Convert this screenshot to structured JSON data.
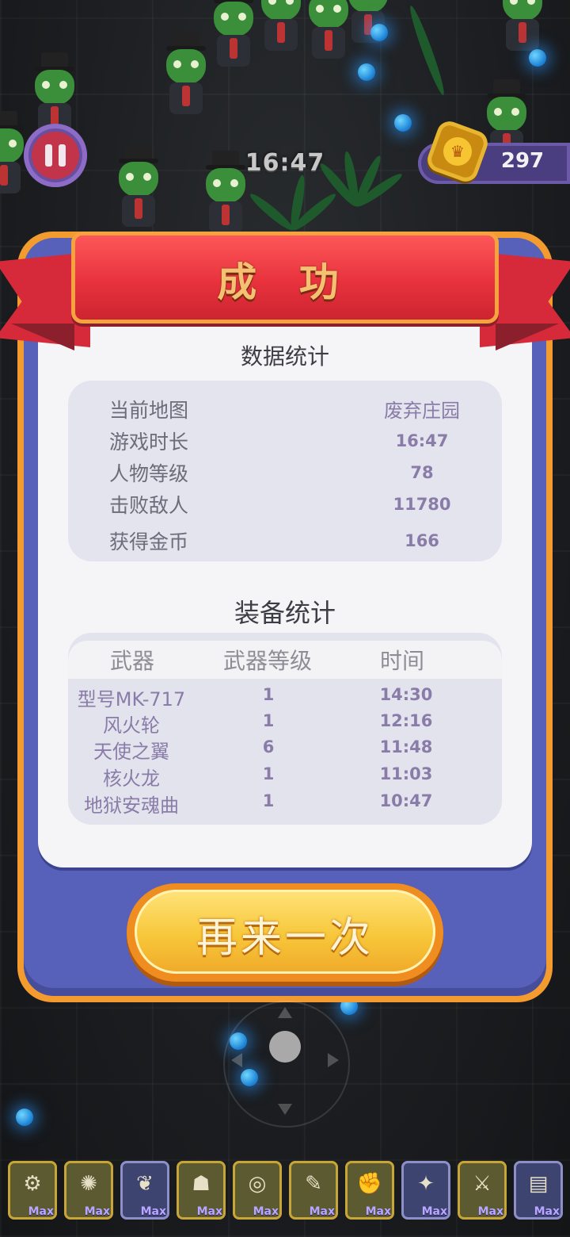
{
  "hud": {
    "timer": "16:47",
    "coins": "297"
  },
  "result": {
    "title": "成 功",
    "stats_title": "数据统计",
    "stats": [
      {
        "label": "当前地图",
        "value": "废弃庄园"
      },
      {
        "label": "游戏时长",
        "value": "16:47"
      },
      {
        "label": "人物等级",
        "value": "78"
      },
      {
        "label": "击败敌人",
        "value": "11780"
      },
      {
        "label": "获得金币",
        "value": "166"
      }
    ],
    "equip_title": "装备统计",
    "equip_headers": {
      "weapon": "武器",
      "level": "武器等级",
      "time": "时间"
    },
    "equipment": [
      {
        "name": "型号MK-717",
        "level": "1",
        "time": "14:30"
      },
      {
        "name": "风火轮",
        "level": "1",
        "time": "12:16"
      },
      {
        "name": "天使之翼",
        "level": "6",
        "time": "11:48"
      },
      {
        "name": "核火龙",
        "level": "1",
        "time": "11:03"
      },
      {
        "name": "地狱安魂曲",
        "level": "1",
        "time": "10:47"
      }
    ],
    "retry_label": "再来一次"
  },
  "weapon_slots": [
    {
      "icon": "gun-icon",
      "glyph": "⚙",
      "max": "Max",
      "style": "gold"
    },
    {
      "icon": "fire-wheel-icon",
      "glyph": "✺",
      "max": "Max",
      "style": "gold"
    },
    {
      "icon": "wings-icon",
      "glyph": "❦",
      "max": "Max",
      "style": "blue"
    },
    {
      "icon": "helmet-icon",
      "glyph": "☗",
      "max": "Max",
      "style": "gold"
    },
    {
      "icon": "target-icon",
      "glyph": "◎",
      "max": "Max",
      "style": "gold"
    },
    {
      "icon": "staff-icon",
      "glyph": "✎",
      "max": "Max",
      "style": "gold"
    },
    {
      "icon": "gauntlet-icon",
      "glyph": "✊",
      "max": "Max",
      "style": "gold"
    },
    {
      "icon": "bat-icon",
      "glyph": "✦",
      "max": "Max",
      "style": "blue"
    },
    {
      "icon": "sword-icon",
      "glyph": "⚔",
      "max": "Max",
      "style": "gold"
    },
    {
      "icon": "book-icon",
      "glyph": "▤",
      "max": "Max",
      "style": "blue"
    }
  ],
  "colors": {
    "panel_frame": "#5861b9",
    "panel_border": "#f39b2e",
    "ribbon": "#e8323d",
    "button": "#f7c73a",
    "stat_text": "#8a7ca8"
  }
}
